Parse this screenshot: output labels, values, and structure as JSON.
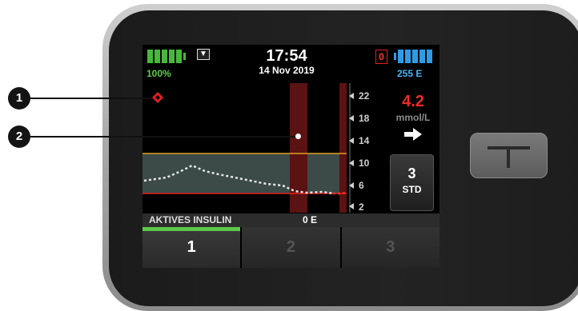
{
  "status_bar": {
    "battery_percent": "100%",
    "battery_level": 1.0,
    "time": "17:54",
    "date": "14 Nov 2019",
    "alert_count": "0",
    "insulin_units": "255 E",
    "icons": {
      "signal": "signal-antenna-icon",
      "battery": "battery-icon",
      "reservoir": "insulin-reservoir-icon"
    }
  },
  "cgm": {
    "reading": "4.2",
    "unit": "mmol/L",
    "trend": "right-arrow-icon",
    "y_ticks": [
      "22",
      "18",
      "14",
      "10",
      "6",
      "2"
    ]
  },
  "bolus_button": {
    "number": "3",
    "label": "STD"
  },
  "insulin_on_board": {
    "label": "AKTIVES INSULIN",
    "value": "0 E"
  },
  "tabs": [
    {
      "label": "1",
      "active": true
    },
    {
      "label": "2",
      "active": false
    },
    {
      "label": "3",
      "active": false
    }
  ],
  "callouts": [
    "1",
    "2"
  ],
  "colors": {
    "battery": "#48b83c",
    "reservoir": "#2f9be6",
    "bg_alert": "#f02a2a",
    "high_threshold": "#e0a020",
    "low_threshold": "#e02020",
    "target_band": "#3c4a48",
    "event_bar": "#5a1212"
  }
}
